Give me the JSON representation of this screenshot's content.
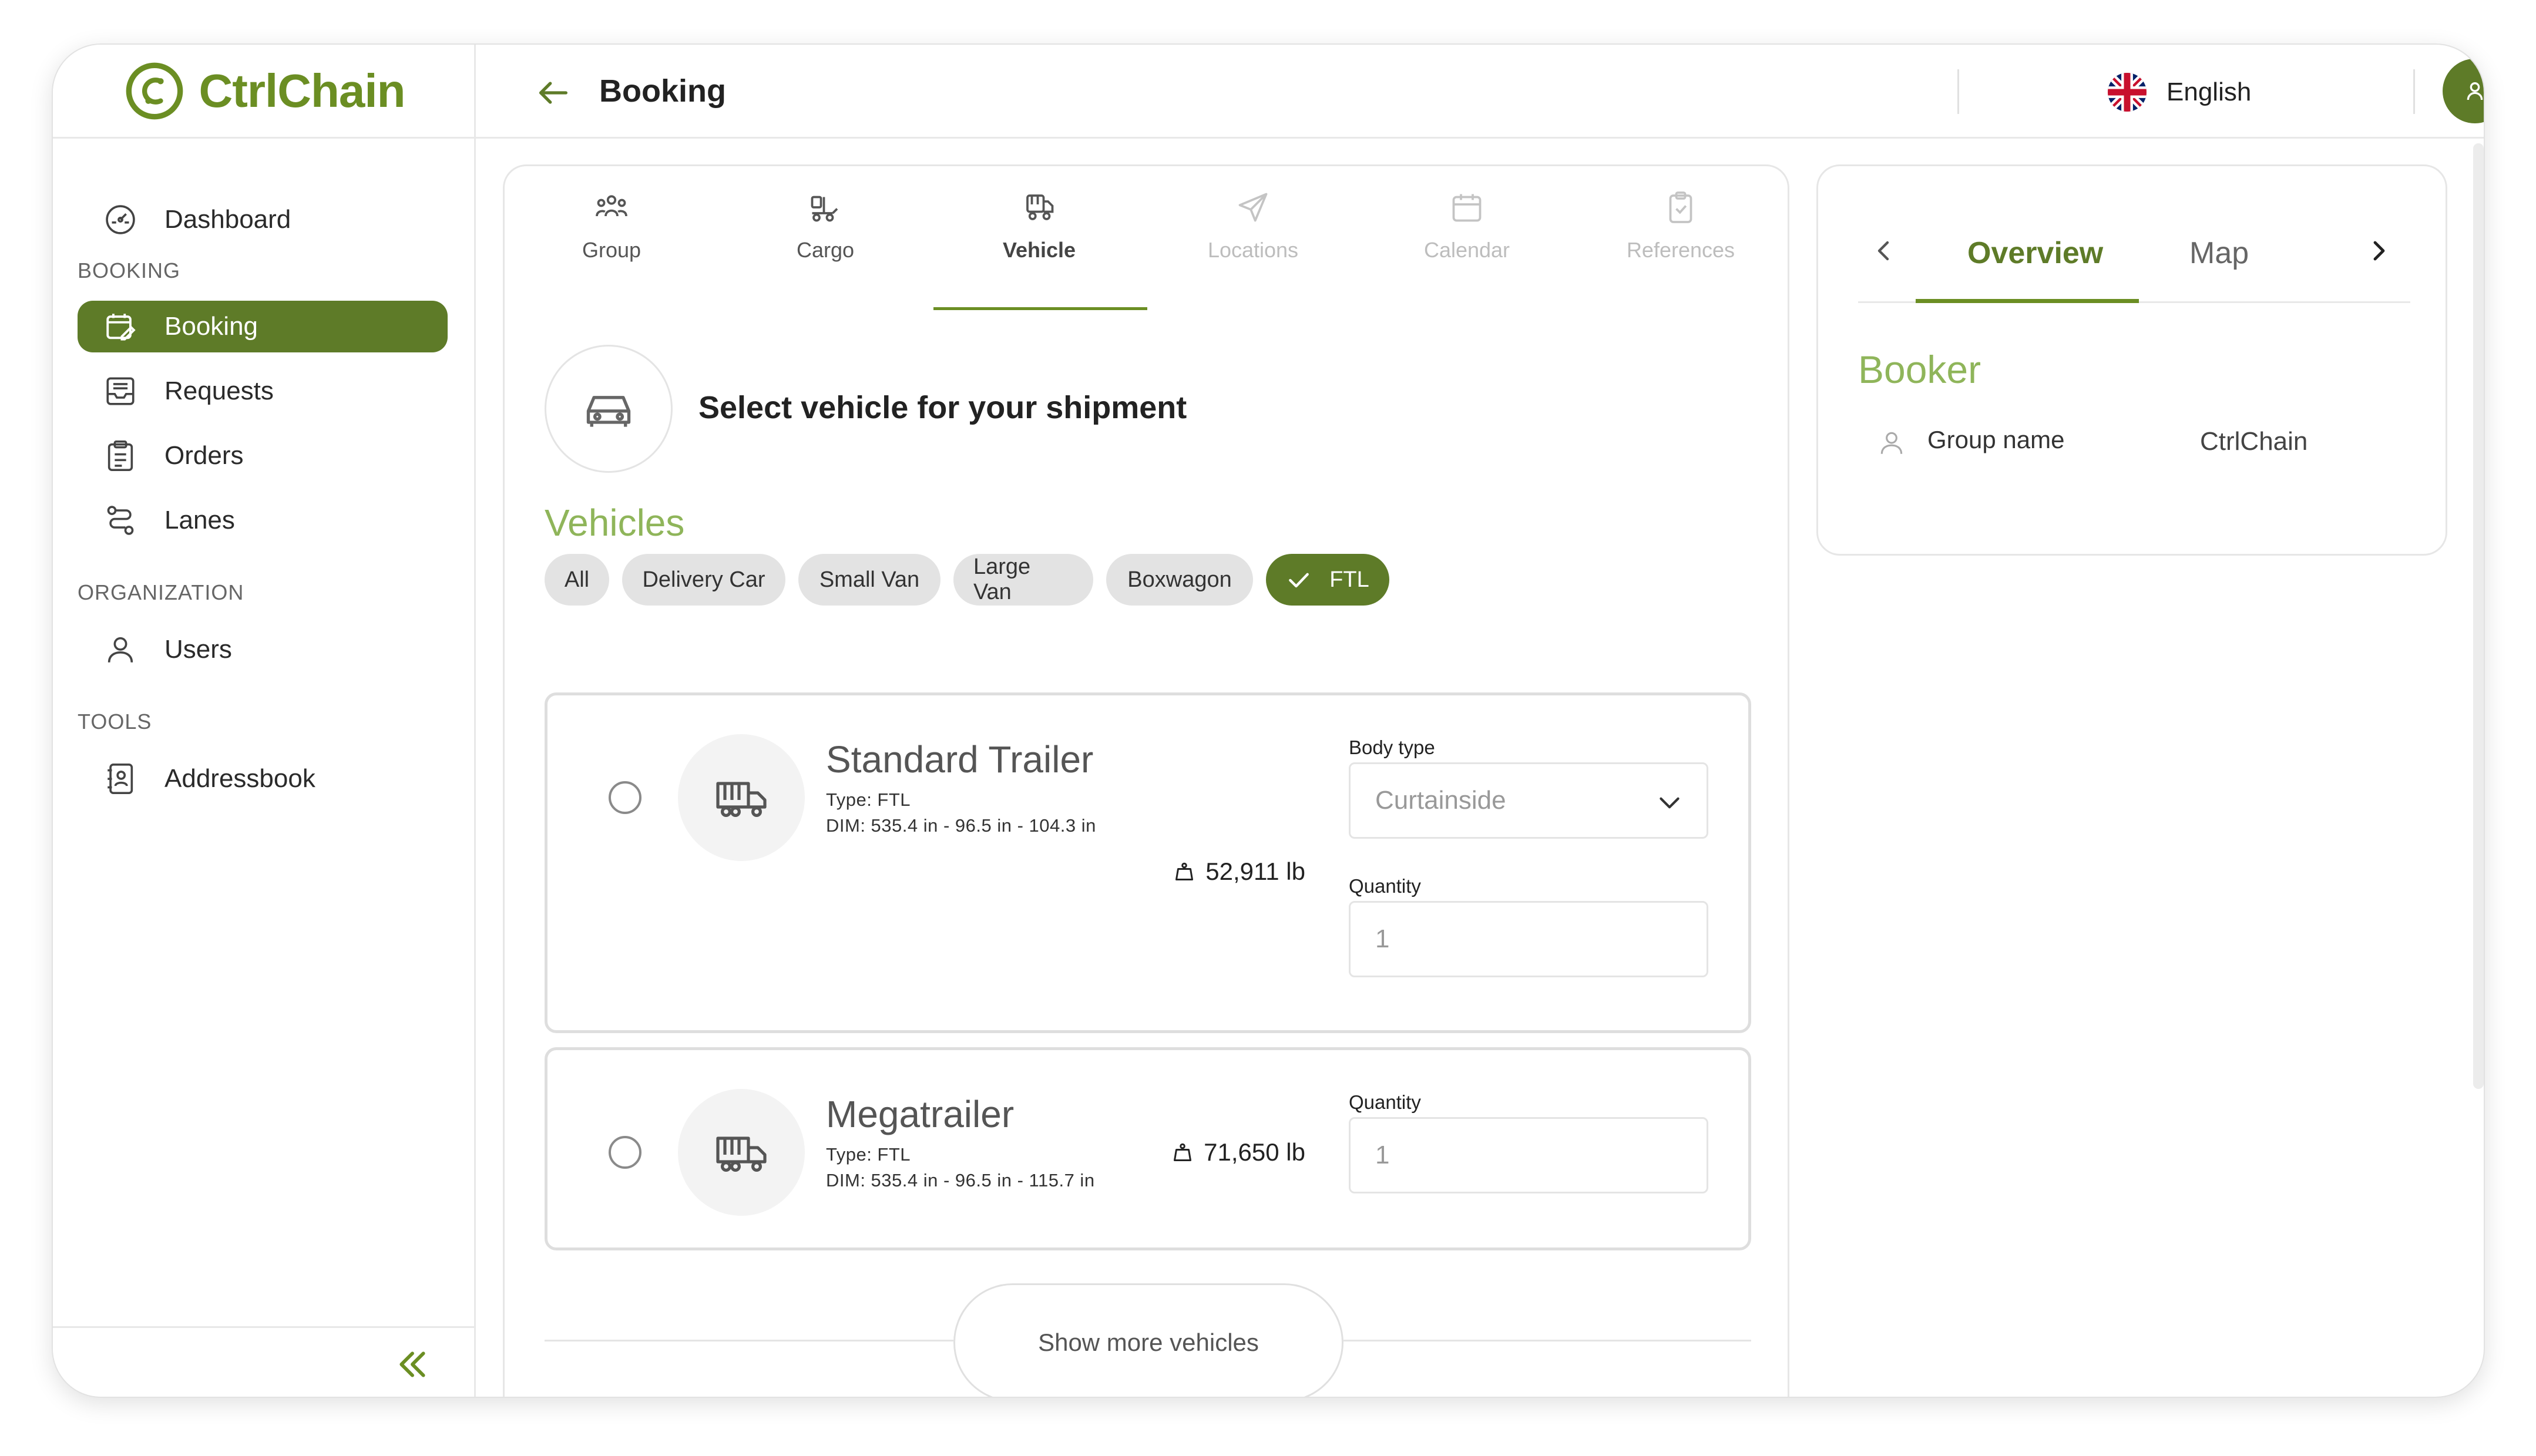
{
  "app": {
    "brand": "CtrlChain",
    "brand_color": "#6b8e23",
    "accent_dark": "#5e7b28",
    "accent_light": "#8fb55a"
  },
  "header": {
    "title": "Booking",
    "back_icon": "arrow-left-icon",
    "language": "English",
    "language_flag": "uk-flag-icon",
    "user_icon": "user-icon"
  },
  "sidebar": {
    "top_item": {
      "label": "Dashboard",
      "icon": "dashboard-icon"
    },
    "sections": [
      {
        "title": "BOOKING",
        "items": [
          {
            "label": "Booking",
            "icon": "calendar-edit-icon",
            "active": true
          },
          {
            "label": "Requests",
            "icon": "inbox-icon"
          },
          {
            "label": "Orders",
            "icon": "clipboard-icon"
          },
          {
            "label": "Lanes",
            "icon": "route-icon"
          }
        ]
      },
      {
        "title": "ORGANIZATION",
        "items": [
          {
            "label": "Users",
            "icon": "user-icon"
          }
        ]
      },
      {
        "title": "TOOLS",
        "items": [
          {
            "label": "Addressbook",
            "icon": "address-book-icon"
          }
        ]
      }
    ],
    "collapse_icon": "double-chevron-left-icon"
  },
  "steps": [
    {
      "label": "Group",
      "icon": "group-icon",
      "state": "done"
    },
    {
      "label": "Cargo",
      "icon": "cargo-icon",
      "state": "done"
    },
    {
      "label": "Vehicle",
      "icon": "vehicle-icon",
      "state": "active"
    },
    {
      "label": "Locations",
      "icon": "send-icon",
      "state": "disabled"
    },
    {
      "label": "Calendar",
      "icon": "calendar-icon",
      "state": "disabled"
    },
    {
      "label": "References",
      "icon": "clipboard-check-icon",
      "state": "disabled"
    }
  ],
  "vehicle_step": {
    "heading": "Select vehicle for your shipment",
    "heading_icon": "car-icon",
    "section_title": "Vehicles",
    "filters": [
      {
        "label": "All",
        "selected": false
      },
      {
        "label": "Delivery Car",
        "selected": false
      },
      {
        "label": "Small Van",
        "selected": false
      },
      {
        "label": "Large Van",
        "selected": false
      },
      {
        "label": "Boxwagon",
        "selected": false
      },
      {
        "label": "FTL",
        "selected": true
      }
    ],
    "vehicles": [
      {
        "name": "Standard Trailer",
        "type": "Type: FTL",
        "dims": "DIM: 535.4 in - 96.5 in - 104.3 in",
        "weight": "52,911 lb",
        "body_type_label": "Body type",
        "body_type_value": "Curtainside",
        "quantity_label": "Quantity",
        "quantity_placeholder": "1"
      },
      {
        "name": "Megatrailer",
        "type": "Type: FTL",
        "dims": "DIM: 535.4 in - 96.5 in - 115.7 in",
        "weight": "71,650 lb",
        "quantity_label": "Quantity",
        "quantity_placeholder": "1"
      }
    ],
    "show_more": "Show more vehicles"
  },
  "overview_panel": {
    "tabs": [
      {
        "label": "Overview",
        "active": true
      },
      {
        "label": "Map",
        "active": false
      }
    ],
    "section_title": "Booker",
    "fields": [
      {
        "label": "Group name",
        "value": "CtrlChain"
      }
    ]
  }
}
